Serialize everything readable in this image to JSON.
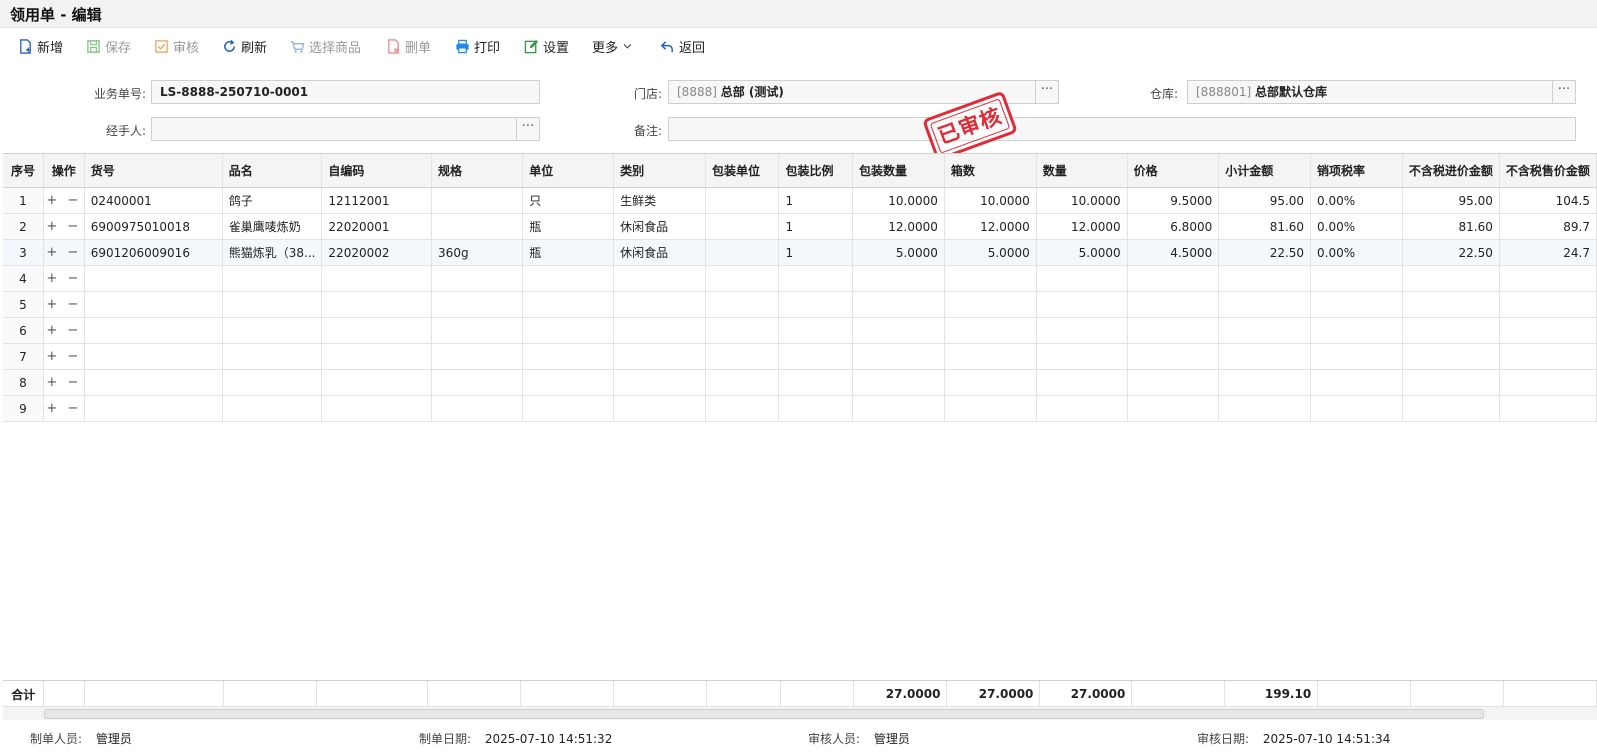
{
  "window": {
    "title": "领用单 - 编辑"
  },
  "toolbar": {
    "new": "新增",
    "save": "保存",
    "audit": "审核",
    "refresh": "刷新",
    "select_goods": "选择商品",
    "delete": "删单",
    "print": "打印",
    "settings": "设置",
    "more": "更多",
    "back": "返回"
  },
  "form": {
    "doc_no_label": "业务单号:",
    "doc_no": "LS-8888-250710-0001",
    "store_label": "门店:",
    "store_code": "[8888]",
    "store_name": "总部 (测试)",
    "warehouse_label": "仓库:",
    "warehouse_code": "[888801]",
    "warehouse_name": "总部默认仓库",
    "handler_label": "经手人:",
    "handler": "",
    "remark_label": "备注:",
    "remark": "",
    "lookup_button": "···",
    "status_stamp": "已审核"
  },
  "grid": {
    "columns": [
      "序号",
      "操作",
      "货号",
      "品名",
      "自编码",
      "规格",
      "单位",
      "类别",
      "包装单位",
      "包装比例",
      "包装数量",
      "箱数",
      "数量",
      "价格",
      "小计金额",
      "销项税率",
      "不含税进价金额",
      "不含税售价金额"
    ],
    "ops": "+ −",
    "rows": [
      {
        "no": "1",
        "code": "02400001",
        "name": "鸽子",
        "self_code": "12112001",
        "spec": "",
        "unit": "只",
        "category": "生鲜类",
        "pack_unit": "",
        "pack_ratio": "1",
        "pack_qty": "10.0000",
        "boxes": "10.0000",
        "qty": "10.0000",
        "price": "9.5000",
        "subtotal": "95.00",
        "tax_rate": "0.00%",
        "cost_ex_tax": "95.00",
        "sale_ex_tax": "104.5"
      },
      {
        "no": "2",
        "code": "6900975010018",
        "name": "雀巢鹰唛炼奶",
        "self_code": "22020001",
        "spec": "",
        "unit": "瓶",
        "category": "休闲食品",
        "pack_unit": "",
        "pack_ratio": "1",
        "pack_qty": "12.0000",
        "boxes": "12.0000",
        "qty": "12.0000",
        "price": "6.8000",
        "subtotal": "81.60",
        "tax_rate": "0.00%",
        "cost_ex_tax": "81.60",
        "sale_ex_tax": "89.7"
      },
      {
        "no": "3",
        "code": "6901206009016",
        "name": "熊猫炼乳（38...",
        "self_code": "22020002",
        "spec": "360g",
        "unit": "瓶",
        "category": "休闲食品",
        "pack_unit": "",
        "pack_ratio": "1",
        "pack_qty": "5.0000",
        "boxes": "5.0000",
        "qty": "5.0000",
        "price": "4.5000",
        "subtotal": "22.50",
        "tax_rate": "0.00%",
        "cost_ex_tax": "22.50",
        "sale_ex_tax": "24.7"
      },
      {
        "no": "4"
      },
      {
        "no": "5"
      },
      {
        "no": "6"
      },
      {
        "no": "7"
      },
      {
        "no": "8"
      },
      {
        "no": "9"
      }
    ]
  },
  "totals": {
    "label": "合计",
    "pack_qty": "27.0000",
    "boxes": "27.0000",
    "qty": "27.0000",
    "subtotal": "199.10"
  },
  "footer": {
    "creator_label": "制单人员:",
    "creator": "管理员",
    "create_date_label": "制单日期:",
    "create_date": "2025-07-10 14:51:32",
    "auditor_label": "审核人员:",
    "auditor": "管理员",
    "audit_date_label": "审核日期:",
    "audit_date": "2025-07-10 14:51:34"
  },
  "colors": {
    "stamp": "#e02a35",
    "save_icon": "#4caf50",
    "print_icon": "#1e88e5",
    "refresh_icon": "#1e62c8"
  }
}
